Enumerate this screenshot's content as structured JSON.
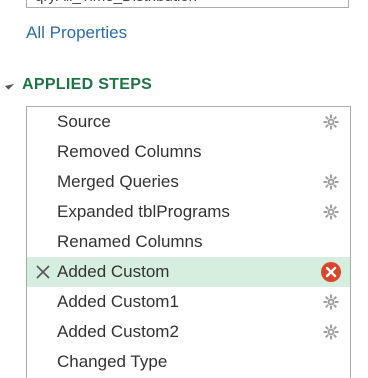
{
  "query_name": {
    "value": "qryAll_Time_Distribution"
  },
  "all_properties_link": "All Properties",
  "applied_steps": {
    "title": "APPLIED STEPS",
    "steps": [
      {
        "label": "Source",
        "has_gear": true
      },
      {
        "label": "Removed Columns",
        "has_gear": false
      },
      {
        "label": "Merged Queries",
        "has_gear": true
      },
      {
        "label": "Expanded tblPrograms",
        "has_gear": true
      },
      {
        "label": "Renamed Columns",
        "has_gear": false
      },
      {
        "label": "Added Custom",
        "has_gear": false,
        "selected": true,
        "has_error": true
      },
      {
        "label": "Added Custom1",
        "has_gear": true
      },
      {
        "label": "Added Custom2",
        "has_gear": true
      },
      {
        "label": "Changed Type",
        "has_gear": false
      }
    ]
  },
  "icons": {
    "gear": "gear-icon",
    "delete": "delete-step-icon",
    "error": "error-icon",
    "collapse": "collapse-triangle-icon"
  },
  "colors": {
    "section_title": "#217346",
    "link": "#2e6da4",
    "selected_row": "#d6eedf",
    "error": "#d9472b",
    "gear": "#a0a0a0"
  }
}
